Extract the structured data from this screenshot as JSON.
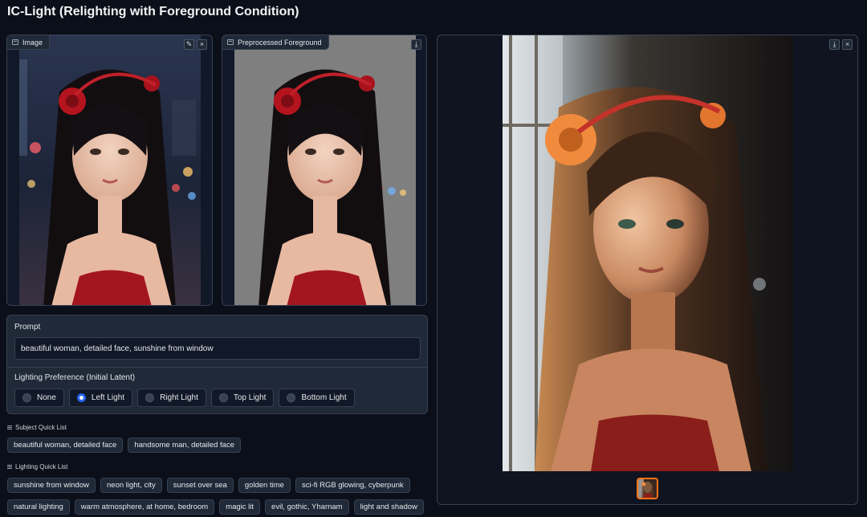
{
  "title": "IC-Light (Relighting with Foreground Condition)",
  "image_panel": {
    "label": "Image",
    "edit_icon": "pencil-icon",
    "close_icon": "close-icon"
  },
  "foreground_panel": {
    "label": "Preprocessed Foreground",
    "download_icon": "download-icon"
  },
  "output_panel": {
    "download_icon": "download-icon",
    "close_icon": "close-icon"
  },
  "prompt": {
    "label": "Prompt",
    "value": "beautiful woman, detailed face, sunshine from window"
  },
  "lighting": {
    "label": "Lighting Preference (Initial Latent)",
    "options": [
      "None",
      "Left Light",
      "Right Light",
      "Top Light",
      "Bottom Light"
    ],
    "selected": "Left Light"
  },
  "subject_list": {
    "label": "Subject Quick List",
    "items": [
      "beautiful woman, detailed face",
      "handsome man, detailed face"
    ]
  },
  "lighting_list": {
    "label": "Lighting Quick List",
    "row1": [
      "sunshine from window",
      "neon light, city",
      "sunset over sea",
      "golden time",
      "sci-fi RGB glowing, cyberpunk"
    ],
    "row2": [
      "natural lighting",
      "warm atmosphere, at home, bedroom",
      "magic lit",
      "evil, gothic, Yharnam",
      "light and shadow"
    ]
  },
  "colors": {
    "accent": "#2563eb",
    "thumb_border": "#f97316",
    "background": "#0b0f19"
  }
}
